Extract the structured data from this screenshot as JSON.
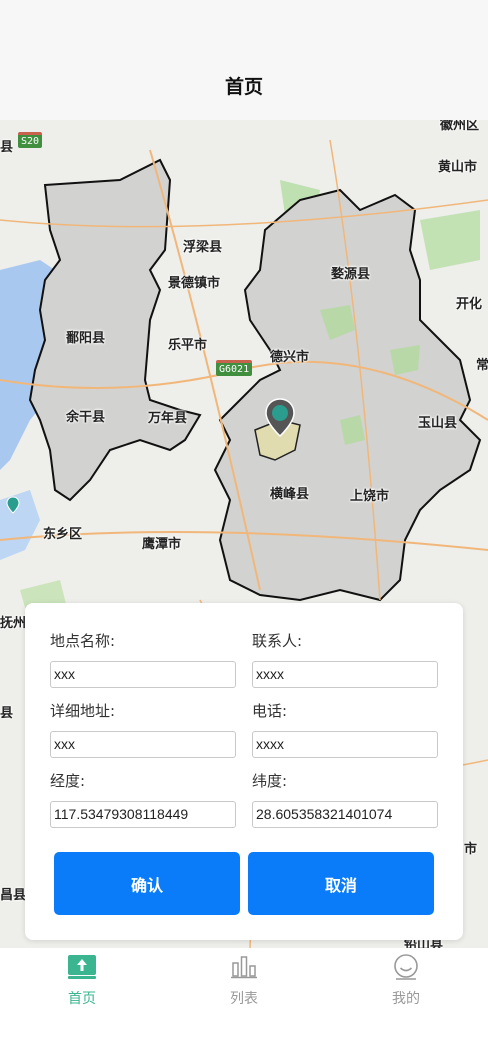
{
  "header": {
    "title": "首页"
  },
  "map": {
    "labels": {
      "huangshan": "黄山市",
      "huizhou": "徽州区",
      "fuliang": "浮梁县",
      "jingdezhen": "景德镇市",
      "wuyuan": "婺源县",
      "kaihua": "开化",
      "poyang": "鄱阳县",
      "leping": "乐平市",
      "dexing": "德兴市",
      "chang": "常",
      "yugan": "余干县",
      "wannian": "万年县",
      "yushan": "玉山县",
      "hengfeng": "横峰县",
      "shangrao": "上饶市",
      "dongxiang": "东乡区",
      "yingtan": "鹰潭市",
      "xian_left": "县",
      "fuzhou": "抚州市",
      "xian_left2": "县",
      "shi_right": "市",
      "xian_left3": "昌县",
      "bottom_cut": "铅山县"
    },
    "shields": {
      "s20": "S20",
      "g6021": "G6021"
    }
  },
  "form": {
    "name_label": "地点名称:",
    "name_value": "xxx",
    "contact_label": "联系人:",
    "contact_value": "xxxx",
    "address_label": "详细地址:",
    "address_value": "xxx",
    "phone_label": "电话:",
    "phone_value": "xxxx",
    "lng_label": "经度:",
    "lng_value": "117.53479308118449",
    "lat_label": "纬度:",
    "lat_value": "28.605358321401074",
    "confirm_label": "确认",
    "cancel_label": "取消"
  },
  "tabbar": {
    "home": "首页",
    "list": "列表",
    "mine": "我的"
  },
  "colors": {
    "accent": "#0a7cfa",
    "active_tab": "#3bb58f",
    "inactive_tab": "#999999",
    "marker": "#2a9d8f"
  }
}
